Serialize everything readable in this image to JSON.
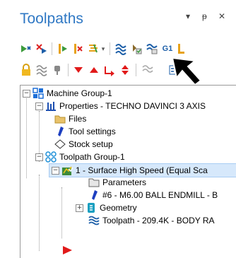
{
  "panel": {
    "title": "Toolpaths",
    "controls": {
      "menu": "▾",
      "pin": "ᵽ",
      "close": "✕"
    }
  },
  "toolbar": {
    "row1": [
      "select-all-ops-icon",
      "deselect-all-icon",
      "regenerate-selected-icon",
      "regenerate-dirty-icon",
      "toggle-display-icon",
      "simulate-icon",
      "verify-icon",
      "backplot-icon",
      "gcode-label",
      "post-icon"
    ],
    "gcode_label": "G1",
    "row2": [
      "lock-icon",
      "wave-icon",
      "pin-icon",
      "move-down-icon",
      "move-up-icon",
      "insert-arrow-icon",
      "move-up-down-icon",
      "scroll-icon",
      "view-options-icon"
    ]
  },
  "tree": {
    "machine_group": "Machine Group-1",
    "properties": "Properties - TECHNO DAVINCI 3 AXIS",
    "files": "Files",
    "tool_settings": "Tool settings",
    "stock_setup": "Stock setup",
    "toolpath_group": "Toolpath Group-1",
    "operation": "1 - Surface High Speed (Equal Sca",
    "parameters": "Parameters",
    "tool": "#6 - M6.00 BALL ENDMILL - B",
    "geometry": "Geometry",
    "toolpath": "Toolpath - 209.4K - BODY RA"
  },
  "colors": {
    "title": "#2f78c4",
    "selection": "#d6e8fb",
    "insert_arrow": "#e11a1a"
  }
}
